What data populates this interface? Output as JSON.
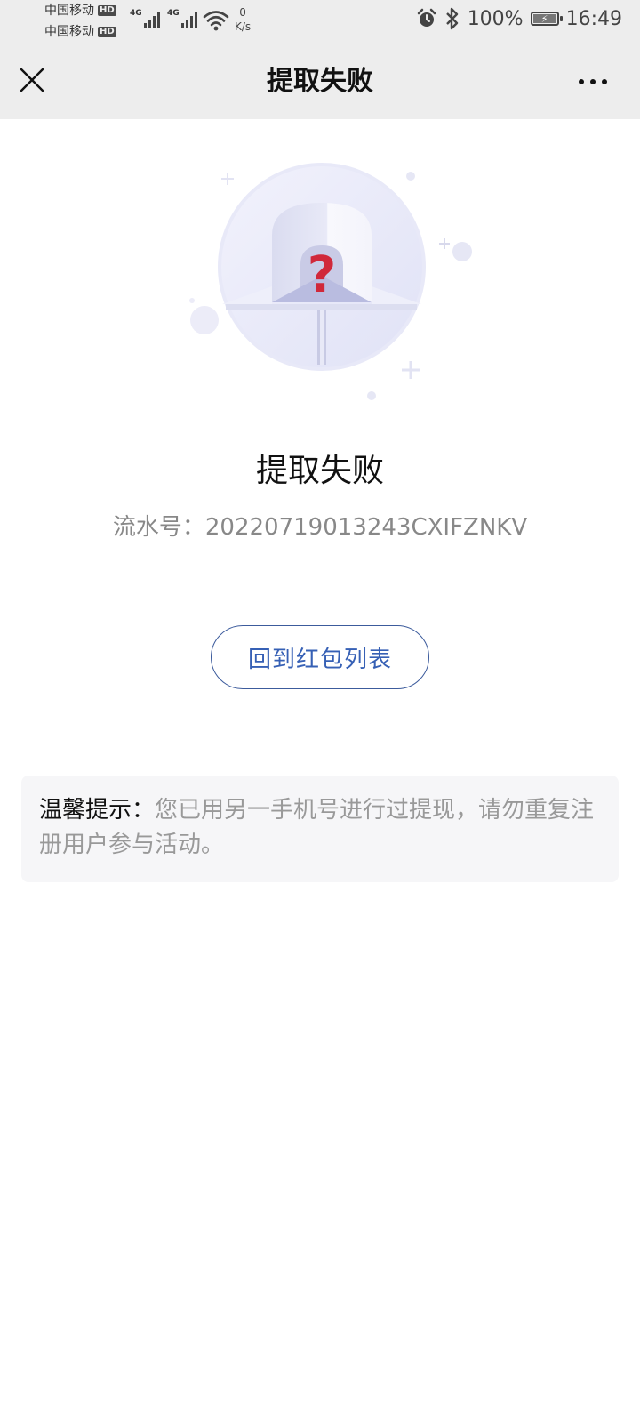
{
  "status_bar": {
    "carrier_1": "中国移动",
    "carrier_2": "中国移动",
    "hd_badge": "HD",
    "network_1": "4G",
    "network_2": "4G",
    "speed_value": "0",
    "speed_unit": "K/s",
    "battery": "100%",
    "battery_level": 1.0,
    "time": "16:49"
  },
  "nav": {
    "title": "提取失败",
    "close_icon": "close-icon",
    "more_icon": "more-dots-icon"
  },
  "result": {
    "illustration_icon": "question-envelope-icon",
    "title": "提取失败",
    "serial_label": "流水号：",
    "serial_number": "20220719013243CXIFZNKV"
  },
  "back_button": {
    "label": "回到红包列表"
  },
  "tip": {
    "label": "温馨提示：",
    "text": "您已用另一手机号进行过提现，请勿重复注册用户参与活动。"
  },
  "colors": {
    "nav_bg": "#ededed",
    "button_text": "#3660b5",
    "button_border": "#3c5b9c",
    "question_mark": "#d0283a",
    "tip_bg": "#f6f6f8"
  }
}
